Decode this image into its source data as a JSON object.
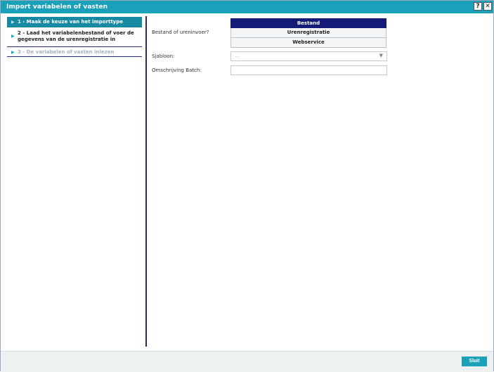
{
  "window": {
    "title": "Import variabelen of vasten",
    "help_label": "?",
    "close_label": "✕"
  },
  "steps": [
    {
      "label": "1 - Maak de keuze van het importtype",
      "state": "active"
    },
    {
      "label": "2 - Laad het variabelenbestand of voer de gegevens van de urenregistratie in",
      "state": "normal"
    },
    {
      "label": "3 - De variabelen of vasten inlezen",
      "state": "disabled"
    }
  ],
  "form": {
    "source_label": "Bestand of ureninvoer?",
    "source_options": [
      "Bestand",
      "Urenregistratie",
      "Webservice"
    ],
    "source_selected": "Bestand",
    "template_label": "Sjabloon:",
    "template_value": "...",
    "description_label": "Omschrijving Batch:",
    "description_value": ""
  },
  "footer": {
    "close_button": "Sluit"
  },
  "colors": {
    "titlebar": "#1aa0b8",
    "active_step": "#1689a3",
    "selected_segment": "#141a78",
    "divider": "#252d7a",
    "primary_button": "#1aa0b8"
  },
  "icons": {
    "step_arrow": "chevron-right-icon",
    "select_arrow": "chevron-down-icon"
  }
}
